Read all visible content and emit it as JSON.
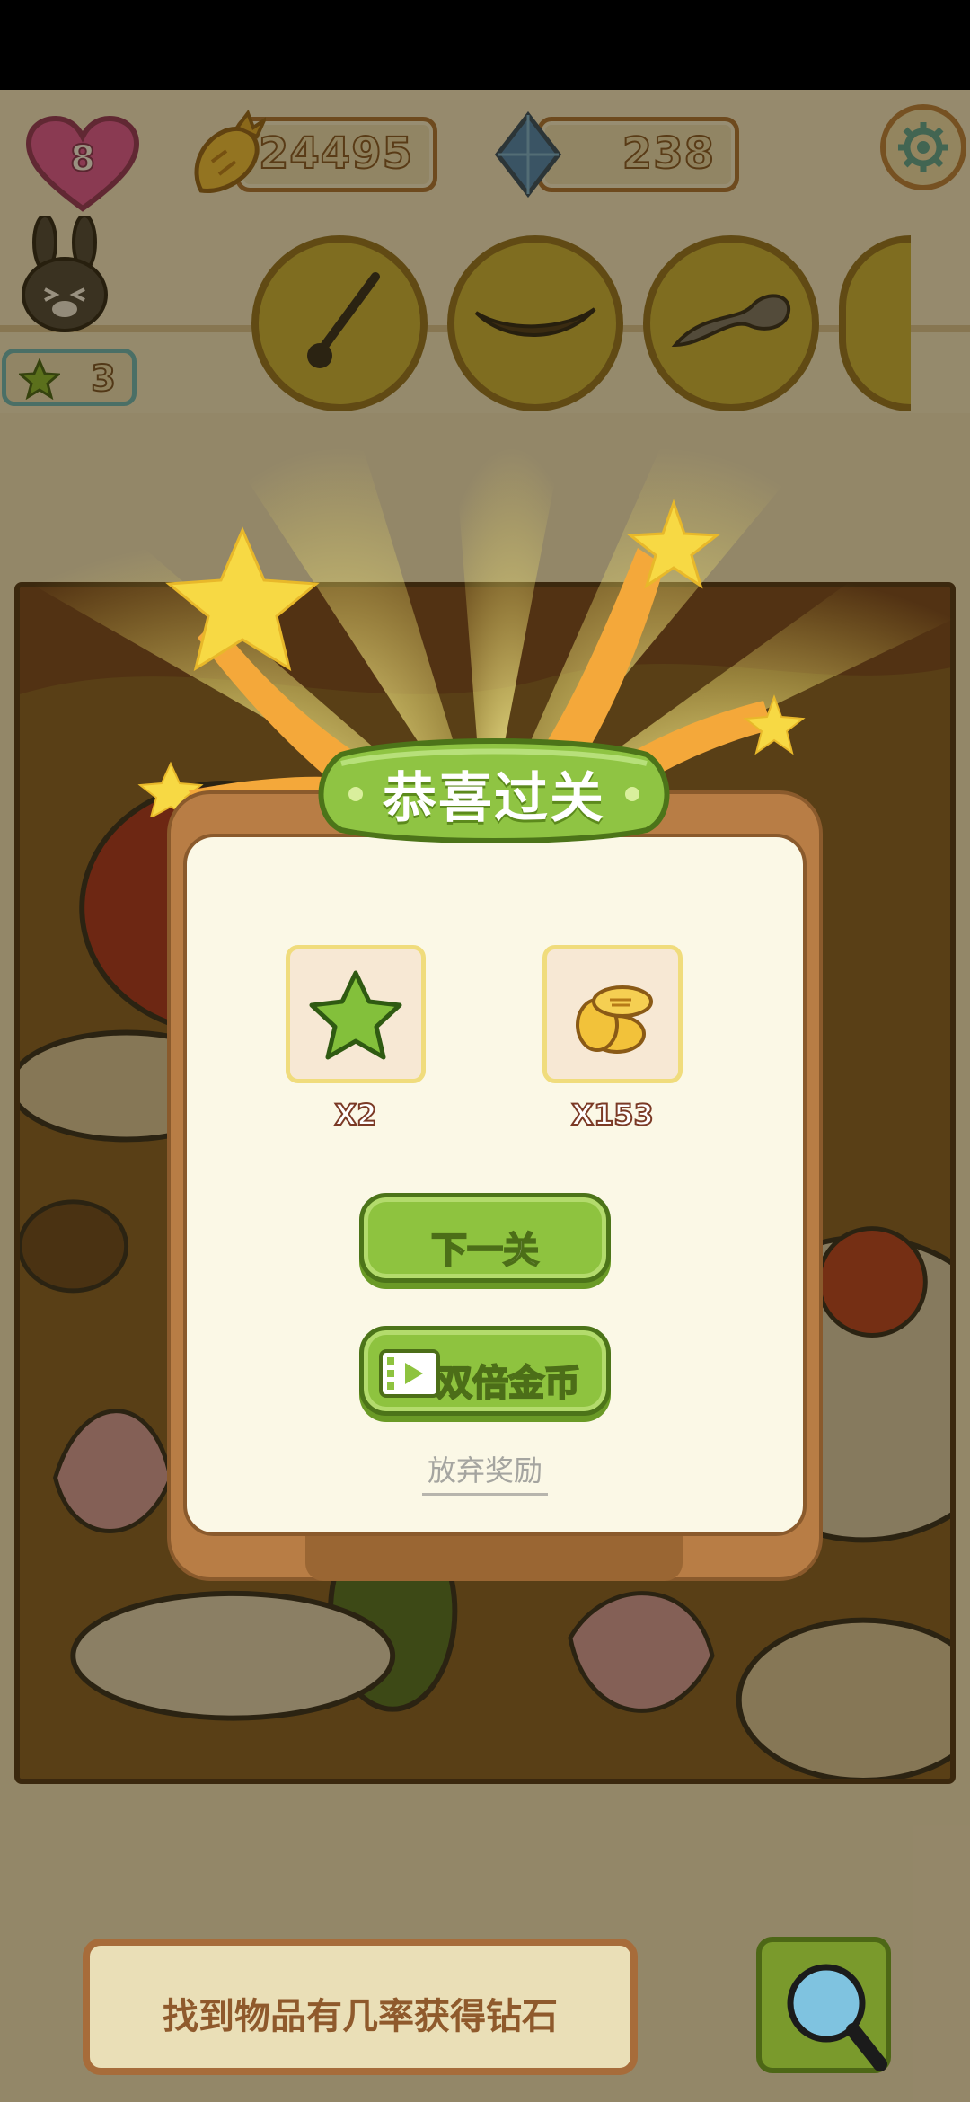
{
  "hud": {
    "lives": "8",
    "coins": "24495",
    "gems": "238",
    "stars": "3"
  },
  "dialog": {
    "title": "恭喜过关",
    "rewards": [
      {
        "icon": "green-star-icon",
        "amount": "X2"
      },
      {
        "icon": "gold-coins-icon",
        "amount": "X153"
      }
    ],
    "next_label": "下一关",
    "double_label": "双倍金币",
    "abandon_label": "放弃奖励"
  },
  "bottom": {
    "hint": "找到物品有几率获得钻石"
  },
  "colors": {
    "accent_green": "#8ec33f",
    "frame_brown": "#b87d45",
    "panel_cream": "#fbf8e6"
  }
}
